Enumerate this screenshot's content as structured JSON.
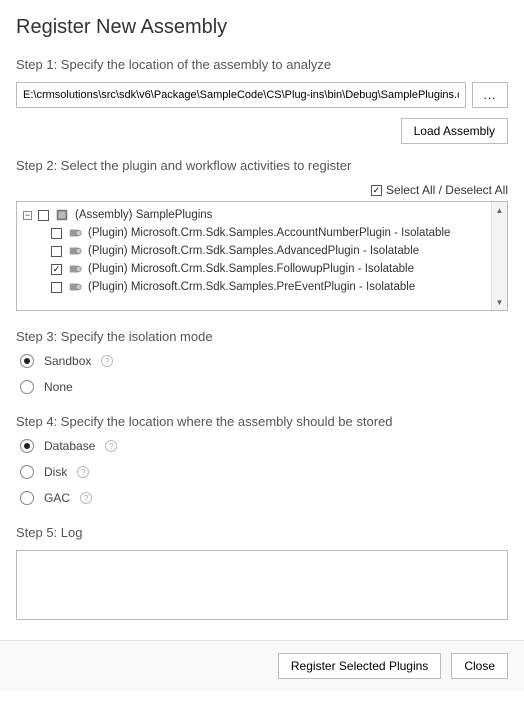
{
  "title": "Register New Assembly",
  "step1": {
    "label": "Step 1: Specify the location of the assembly to analyze",
    "path": "E:\\crmsolutions\\src\\sdk\\v6\\Package\\SampleCode\\CS\\Plug-ins\\bin\\Debug\\SamplePlugins.dll",
    "browse": "...",
    "loadButton": "Load Assembly"
  },
  "step2": {
    "label": "Step 2: Select the plugin and workflow activities to register",
    "selectAllLabel": "Select All / Deselect All",
    "selectAllChecked": true,
    "assembly": {
      "label": "(Assembly) SamplePlugins",
      "expanded": true,
      "checked": false
    },
    "plugins": [
      {
        "label": "(Plugin) Microsoft.Crm.Sdk.Samples.AccountNumberPlugin - Isolatable",
        "checked": false
      },
      {
        "label": "(Plugin) Microsoft.Crm.Sdk.Samples.AdvancedPlugin - Isolatable",
        "checked": false
      },
      {
        "label": "(Plugin) Microsoft.Crm.Sdk.Samples.FollowupPlugin - Isolatable",
        "checked": true
      },
      {
        "label": "(Plugin) Microsoft.Crm.Sdk.Samples.PreEventPlugin - Isolatable",
        "checked": false
      }
    ]
  },
  "step3": {
    "label": "Step 3: Specify the isolation mode",
    "options": [
      {
        "label": "Sandbox",
        "selected": true,
        "help": true
      },
      {
        "label": "None",
        "selected": false,
        "help": false
      }
    ]
  },
  "step4": {
    "label": "Step 4: Specify the location where the assembly should be stored",
    "options": [
      {
        "label": "Database",
        "selected": true,
        "help": true
      },
      {
        "label": "Disk",
        "selected": false,
        "help": true
      },
      {
        "label": "GAC",
        "selected": false,
        "help": true
      }
    ]
  },
  "step5": {
    "label": "Step 5: Log"
  },
  "footer": {
    "register": "Register Selected Plugins",
    "close": "Close"
  }
}
